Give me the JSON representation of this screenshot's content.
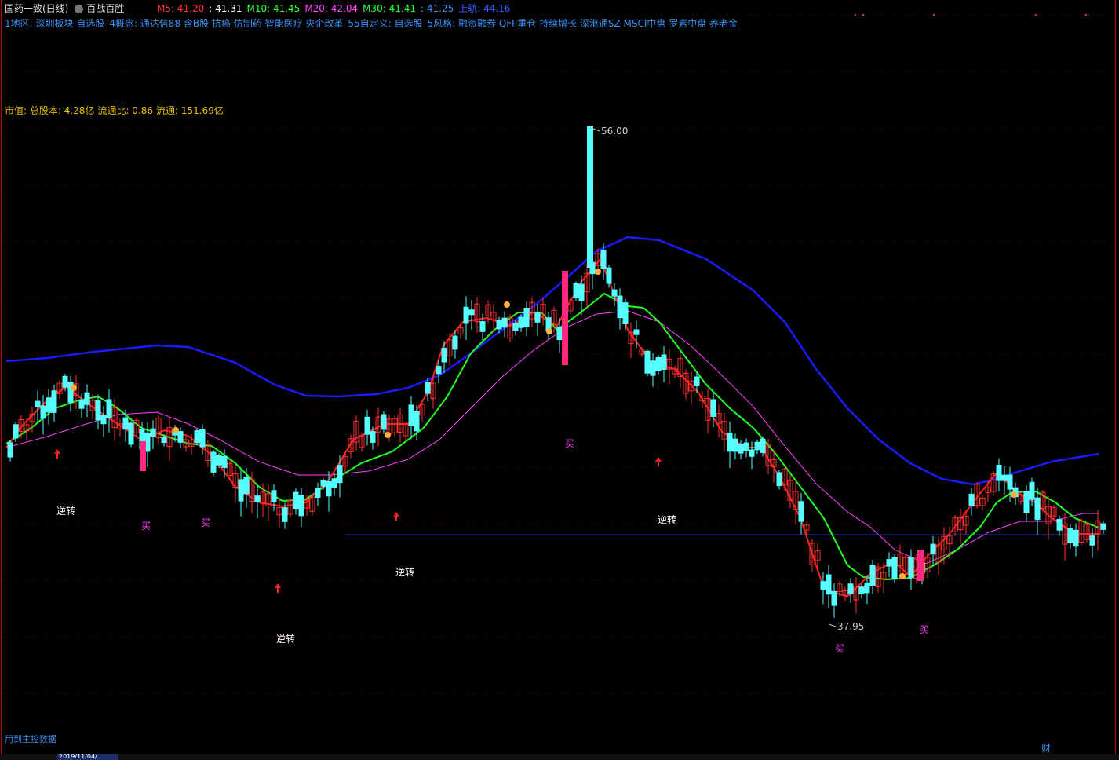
{
  "header": {
    "title": "国药一致(日线)",
    "indicator_name": "百战百胜",
    "ma": [
      {
        "label": "M5: 41.20",
        "color": "#ff3030"
      },
      {
        "label": ": 41.31",
        "color": "#ffffff"
      },
      {
        "label": "M10: 41.45",
        "color": "#30ff30"
      },
      {
        "label": "M20: 42.04",
        "color": "#ff40ff"
      },
      {
        "label": "M30: 41.41",
        "color": "#30ff30"
      },
      {
        "label": ": 41.25",
        "color": "#3a8ff0"
      },
      {
        "label": "上轨: 44.16",
        "color": "#3060ff"
      }
    ]
  },
  "info_tags": [
    "1地区: 深圳板块 自选股",
    "4概念: 通达信88 含B股 抗癌 仿制药 智能医疗 央企改革",
    "55自定义: 自选股",
    "5风格: 融资融券 QFII重仓 持续增长 深港通SZ MSCI中盘 罗素中盘 养老金"
  ],
  "capital": [
    "市值: 总股本: 4.28亿",
    "流通比: 0.86",
    "流通: 151.69亿"
  ],
  "footer": {
    "left_label": "用到主控数据",
    "right_label": "财",
    "date_box": "2019/11/04/"
  },
  "chart_data": {
    "type": "candlestick",
    "y_high_label": "56.00",
    "y_low_label": "37.95",
    "annotations": {
      "reverse": "逆转",
      "buy": "买"
    },
    "colors": {
      "up": "#ff3030",
      "down": "#55ffff",
      "ma5": "#ff2020",
      "ma10": "#20ff20",
      "ma20": "#ff40ff",
      "upper": "#1a1aff",
      "flat": "#2030c0"
    }
  }
}
